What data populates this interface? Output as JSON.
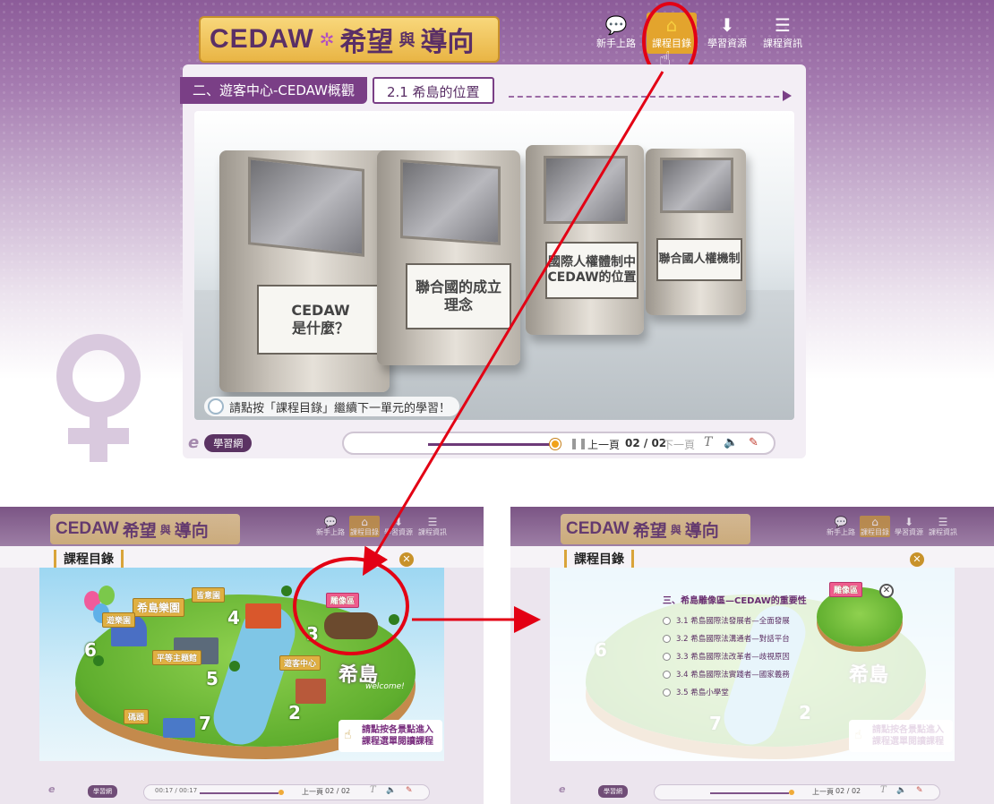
{
  "header": {
    "logo_en": "CEDAW",
    "logo_zh_1": "希望",
    "logo_zh_small": "與",
    "logo_zh_2": "導向",
    "nav": [
      {
        "label": "新手上路",
        "icon": "chat-icon"
      },
      {
        "label": "課程目錄",
        "icon": "home-icon",
        "active": true
      },
      {
        "label": "學習資源",
        "icon": "download-icon"
      },
      {
        "label": "課程資訊",
        "icon": "list-icon"
      }
    ]
  },
  "breadcrumb": {
    "main": "二、遊客中心-CEDAW概觀",
    "sub": "2.1 希島的位置"
  },
  "kiosks": [
    {
      "label_line1": "CEDAW",
      "label_line2": "是什麼？"
    },
    {
      "label_line1": "聯合國的成立",
      "label_line2": "理念"
    },
    {
      "label_line1": "國際人權體制中",
      "label_line2": "CEDAW的位置"
    },
    {
      "label_line1": "聯合國人權機制",
      "label_line2": ""
    }
  ],
  "hint": "請點按「課程目錄」繼續下一單元的學習！",
  "brand_pill": "學習網",
  "player": {
    "prev": "上一頁",
    "pages": "02 / 02",
    "next": "下一頁"
  },
  "panel": {
    "title": "課程目錄",
    "map_title": "希島",
    "welcome": "welcome!",
    "tip_line1": "請點按各景點進入",
    "tip_line2": "課程選單閱讀課程",
    "places": [
      {
        "num": "2",
        "name": "遊客中心"
      },
      {
        "num": "3",
        "name": "雕像區"
      },
      {
        "num": "4",
        "name": "皆意園"
      },
      {
        "num": "5",
        "name": "平等主題館"
      },
      {
        "num": "6",
        "name": "遊樂園"
      },
      {
        "num": "7",
        "name": "碼頭"
      }
    ],
    "park_sign": "希島樂園",
    "mini_player_time": "00:17 / 00:17",
    "mini_player_prev": "上一頁",
    "mini_player_pages": "02 / 02"
  },
  "submenu": {
    "title": "三、希島雕像區—CEDAW的重要性",
    "items": [
      "3.1 希島國際法發展者—全面發展",
      "3.2 希島國際法溝通者—對話平台",
      "3.3 希島國際法改革者—歧視原因",
      "3.4 希島國際法實踐者—國家義務",
      "3.5 希島小學堂"
    ],
    "sign": "雕像區"
  }
}
